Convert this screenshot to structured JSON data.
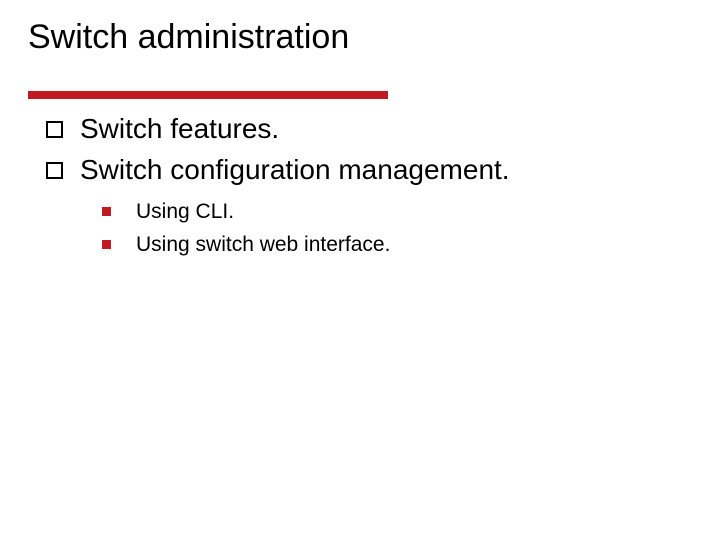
{
  "title": "Switch administration",
  "colors": {
    "accent": "#c11920"
  },
  "bullets": {
    "level1": [
      {
        "text": "Switch features."
      },
      {
        "text": "Switch configuration management."
      }
    ],
    "level2": [
      {
        "text": "Using CLI."
      },
      {
        "text": "Using switch web interface."
      }
    ]
  }
}
